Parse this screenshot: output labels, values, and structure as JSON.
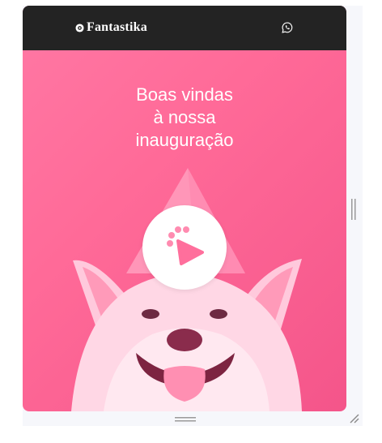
{
  "header": {
    "brand": "Fantastika",
    "brand_icon": "badge-icon",
    "contact_icon": "whatsapp-icon"
  },
  "hero": {
    "line1": "Boas vindas",
    "line2": "à nossa",
    "line3": "inauguração",
    "play_icon": "paw-play-icon"
  },
  "colors": {
    "topbar": "#232323",
    "hero_pink": "#ff6a98",
    "text": "#ffffff"
  }
}
